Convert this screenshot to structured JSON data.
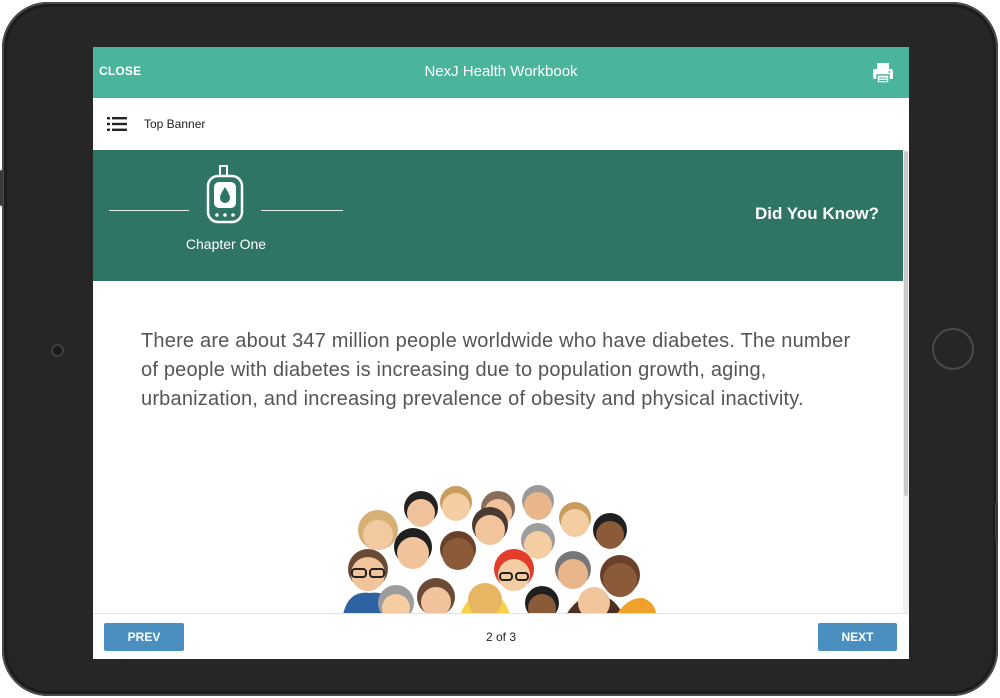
{
  "app": {
    "close_label": "CLOSE",
    "title": "NexJ Health Workbook",
    "print_icon": "printer-icon"
  },
  "nav": {
    "menu_icon": "hamburger-menu-icon",
    "title": "Top Banner"
  },
  "banner": {
    "icon": "glucometer-icon",
    "chapter": "Chapter One",
    "heading": "Did You Know?"
  },
  "content": {
    "fact": "There are about 347 million people worldwide who have diabetes. The number of people with diabetes is increasing due to population growth, aging, urbanization, and increasing prevalence of obesity and physical inactivity.",
    "illustration": "crowd-of-people-illustration"
  },
  "footer": {
    "prev_label": "PREV",
    "page_indicator": "2 of 3",
    "next_label": "NEXT"
  },
  "colors": {
    "header": "#4ab59c",
    "banner": "#2e7565",
    "button": "#4a8fc0"
  }
}
